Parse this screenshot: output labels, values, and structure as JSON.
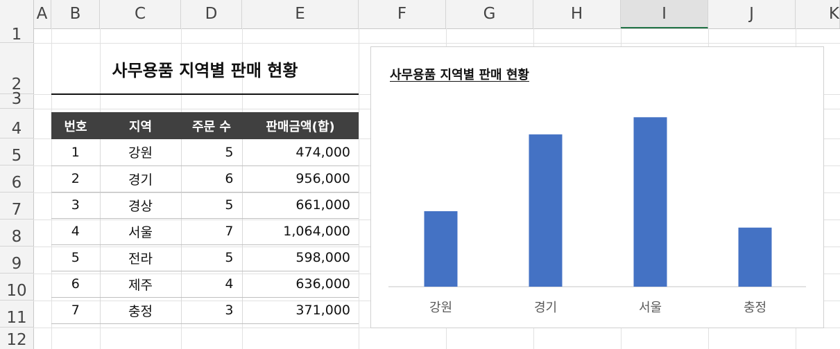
{
  "columns": [
    "A",
    "B",
    "C",
    "D",
    "E",
    "F",
    "G",
    "H",
    "I",
    "J",
    "K"
  ],
  "selected_column": "I",
  "rows": [
    "1",
    "2",
    "3",
    "4",
    "5",
    "6",
    "7",
    "8",
    "9",
    "10",
    "11",
    "12"
  ],
  "sheet": {
    "title": "사무용품 지역별 판매 현황",
    "headers": [
      "번호",
      "지역",
      "주문 수",
      "판매금액(합)"
    ],
    "records": [
      {
        "no": "1",
        "region": "강원",
        "orders": "5",
        "amount": "474,000"
      },
      {
        "no": "2",
        "region": "경기",
        "orders": "6",
        "amount": "956,000"
      },
      {
        "no": "3",
        "region": "경상",
        "orders": "5",
        "amount": "661,000"
      },
      {
        "no": "4",
        "region": "서울",
        "orders": "7",
        "amount": "1,064,000"
      },
      {
        "no": "5",
        "region": "전라",
        "orders": "5",
        "amount": "598,000"
      },
      {
        "no": "6",
        "region": "제주",
        "orders": "4",
        "amount": "636,000"
      },
      {
        "no": "7",
        "region": "충정",
        "orders": "3",
        "amount": "371,000"
      }
    ]
  },
  "chart_data": {
    "type": "bar",
    "title": "사무용품 지역별 판매 현황",
    "categories": [
      "강원",
      "경기",
      "서울",
      "충정"
    ],
    "values": [
      474000,
      956000,
      1064000,
      371000
    ],
    "ylim": [
      0,
      1200000
    ],
    "bar_color": "#4472c4",
    "grid": false,
    "legend": "none"
  },
  "colors": {
    "header_fill": "#404040",
    "selected_column_accent": "#217346"
  }
}
